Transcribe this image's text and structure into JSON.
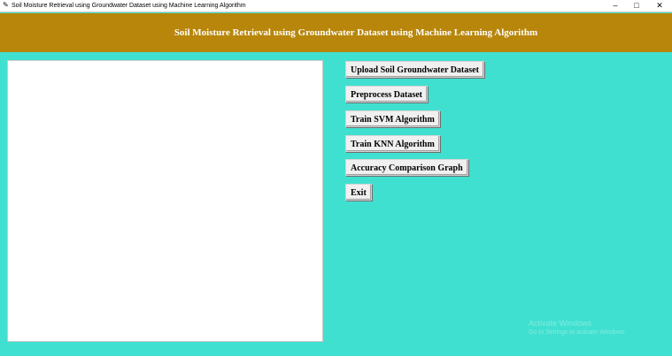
{
  "window": {
    "title": "Soil Moisture Retrieval using Groundwater Dataset using Machine Learning Algorithm",
    "icon": "feather-icon",
    "controls": {
      "minimize": "–",
      "maximize": "□",
      "close": "✕"
    }
  },
  "header": {
    "title": "Soil Moisture Retrieval using Groundwater Dataset using Machine Learning Algorithm"
  },
  "output": {
    "text": ""
  },
  "buttons": {
    "upload": "Upload Soil Groundwater Dataset",
    "preprocess": "Preprocess Dataset",
    "svm": "Train SVM Algorithm",
    "knn": "Train KNN Algorithm",
    "graph": "Accuracy Comparison Graph",
    "exit": "Exit"
  },
  "watermark": {
    "line1": "Activate Windows",
    "line2": "Go to Settings to activate Windows."
  },
  "colors": {
    "background": "#40e0d0",
    "banner": "#b8860b",
    "banner_text": "#ffffff"
  }
}
